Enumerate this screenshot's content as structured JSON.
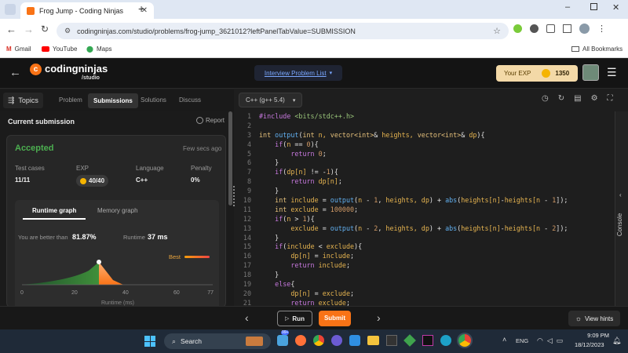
{
  "browser": {
    "tab_title": "Frog Jump - Coding Ninjas",
    "url": "codingninjas.com/studio/problems/frog-jump_3621012?leftPanelTabValue=SUBMISSION",
    "bookmarks": [
      "Gmail",
      "YouTube",
      "Maps"
    ],
    "all_bookmarks": "All Bookmarks"
  },
  "header": {
    "brand": "codingninjas",
    "brand_sub": "/studio",
    "nav_link": "Interview Problem List",
    "exp_label": "Your EXP",
    "exp_value": "1350"
  },
  "left_tabs": {
    "topics": "Topics",
    "items": [
      "Problem",
      "Submissions",
      "Solutions",
      "Discuss"
    ],
    "active": "Submissions"
  },
  "submission": {
    "heading": "Current submission",
    "report": "Report",
    "status": "Accepted",
    "time": "Few secs ago",
    "stats": [
      {
        "label": "Test cases",
        "value": "11/11"
      },
      {
        "label": "EXP",
        "value": "40/40"
      },
      {
        "label": "Language",
        "value": "C++"
      },
      {
        "label": "Penalty",
        "value": "0%"
      }
    ],
    "graph_tabs": [
      "Runtime graph",
      "Memory graph"
    ],
    "better_than_label": "You are better than",
    "better_than_value": "81.87%",
    "runtime_label": "Runtime",
    "runtime_value": "37 ms",
    "best_label": "Best",
    "x_ticks": [
      "0",
      "20",
      "40",
      "60",
      "77"
    ],
    "x_axis_label": "Runtime (ms)"
  },
  "editor": {
    "language": "C++ (g++ 5.4)",
    "lines": [
      {
        "n": "1",
        "tokens": [
          [
            "pp",
            "#include "
          ],
          [
            "str",
            "<bits/stdc++.h>"
          ]
        ]
      },
      {
        "n": "2",
        "tokens": []
      },
      {
        "n": "3",
        "tokens": [
          [
            "ty",
            "int "
          ],
          [
            "fn",
            "output"
          ],
          [
            "op",
            "("
          ],
          [
            "ty",
            "int "
          ],
          [
            "tx",
            "n, "
          ],
          [
            "ty",
            "vector<int>"
          ],
          [
            "op",
            "& "
          ],
          [
            "tx",
            "heights, "
          ],
          [
            "ty",
            "vector<int>"
          ],
          [
            "op",
            "& "
          ],
          [
            "tx",
            "dp"
          ],
          [
            "op",
            "){"
          ]
        ]
      },
      {
        "n": "4",
        "tokens": [
          [
            "op",
            "    "
          ],
          [
            "kw",
            "if"
          ],
          [
            "op",
            "("
          ],
          [
            "tx",
            "n "
          ],
          [
            "op",
            "== "
          ],
          [
            "nm",
            "0"
          ],
          [
            "op",
            "){"
          ]
        ]
      },
      {
        "n": "5",
        "tokens": [
          [
            "op",
            "        "
          ],
          [
            "kw",
            "return "
          ],
          [
            "nm",
            "0"
          ],
          [
            "op",
            ";"
          ]
        ]
      },
      {
        "n": "6",
        "tokens": [
          [
            "op",
            "    }"
          ]
        ]
      },
      {
        "n": "7",
        "tokens": [
          [
            "op",
            "    "
          ],
          [
            "kw",
            "if"
          ],
          [
            "op",
            "("
          ],
          [
            "tx",
            "dp[n] "
          ],
          [
            "op",
            "!= -"
          ],
          [
            "nm",
            "1"
          ],
          [
            "op",
            "){"
          ]
        ]
      },
      {
        "n": "8",
        "tokens": [
          [
            "op",
            "        "
          ],
          [
            "kw",
            "return "
          ],
          [
            "tx",
            "dp[n]"
          ],
          [
            "op",
            ";"
          ]
        ]
      },
      {
        "n": "9",
        "tokens": [
          [
            "op",
            "    }"
          ]
        ]
      },
      {
        "n": "10",
        "tokens": [
          [
            "op",
            "    "
          ],
          [
            "ty",
            "int "
          ],
          [
            "tx",
            "include "
          ],
          [
            "op",
            "= "
          ],
          [
            "fn",
            "output"
          ],
          [
            "op",
            "("
          ],
          [
            "tx",
            "n "
          ],
          [
            "op",
            "- "
          ],
          [
            "nm",
            "1"
          ],
          [
            "op",
            ", "
          ],
          [
            "tx",
            "heights, dp"
          ],
          [
            "op",
            ") + "
          ],
          [
            "fn",
            "abs"
          ],
          [
            "op",
            "("
          ],
          [
            "tx",
            "heights[n]"
          ],
          [
            "op",
            "-"
          ],
          [
            "tx",
            "heights[n "
          ],
          [
            "op",
            "- "
          ],
          [
            "nm",
            "1"
          ],
          [
            "op",
            "]);"
          ]
        ]
      },
      {
        "n": "11",
        "tokens": [
          [
            "op",
            "    "
          ],
          [
            "ty",
            "int "
          ],
          [
            "tx",
            "exclude "
          ],
          [
            "op",
            "= "
          ],
          [
            "nm",
            "100000"
          ],
          [
            "op",
            ";"
          ]
        ]
      },
      {
        "n": "12",
        "tokens": [
          [
            "op",
            "    "
          ],
          [
            "kw",
            "if"
          ],
          [
            "op",
            "("
          ],
          [
            "tx",
            "n "
          ],
          [
            "op",
            "> "
          ],
          [
            "nm",
            "1"
          ],
          [
            "op",
            "){"
          ]
        ]
      },
      {
        "n": "13",
        "tokens": [
          [
            "op",
            "        "
          ],
          [
            "tx",
            "exclude "
          ],
          [
            "op",
            "= "
          ],
          [
            "fn",
            "output"
          ],
          [
            "op",
            "("
          ],
          [
            "tx",
            "n "
          ],
          [
            "op",
            "- "
          ],
          [
            "nm",
            "2"
          ],
          [
            "op",
            ", "
          ],
          [
            "tx",
            "heights, dp"
          ],
          [
            "op",
            ") + "
          ],
          [
            "fn",
            "abs"
          ],
          [
            "op",
            "("
          ],
          [
            "tx",
            "heights[n]"
          ],
          [
            "op",
            "-"
          ],
          [
            "tx",
            "heights[n "
          ],
          [
            "op",
            "- "
          ],
          [
            "nm",
            "2"
          ],
          [
            "op",
            "]);"
          ]
        ]
      },
      {
        "n": "14",
        "tokens": [
          [
            "op",
            "    }"
          ]
        ]
      },
      {
        "n": "15",
        "tokens": [
          [
            "op",
            "    "
          ],
          [
            "kw",
            "if"
          ],
          [
            "op",
            "("
          ],
          [
            "tx",
            "include "
          ],
          [
            "op",
            "< "
          ],
          [
            "tx",
            "exclude"
          ],
          [
            "op",
            "){"
          ]
        ]
      },
      {
        "n": "16",
        "tokens": [
          [
            "op",
            "        "
          ],
          [
            "tx",
            "dp[n] "
          ],
          [
            "op",
            "= "
          ],
          [
            "tx",
            "include"
          ],
          [
            "op",
            ";"
          ]
        ]
      },
      {
        "n": "17",
        "tokens": [
          [
            "op",
            "        "
          ],
          [
            "kw",
            "return "
          ],
          [
            "tx",
            "include"
          ],
          [
            "op",
            ";"
          ]
        ]
      },
      {
        "n": "18",
        "tokens": [
          [
            "op",
            "    }"
          ]
        ]
      },
      {
        "n": "19",
        "tokens": [
          [
            "op",
            "    "
          ],
          [
            "kw",
            "else"
          ],
          [
            "op",
            "{"
          ]
        ]
      },
      {
        "n": "20",
        "tokens": [
          [
            "op",
            "        "
          ],
          [
            "tx",
            "dp[n] "
          ],
          [
            "op",
            "= "
          ],
          [
            "tx",
            "exclude"
          ],
          [
            "op",
            ";"
          ]
        ]
      },
      {
        "n": "21",
        "tokens": [
          [
            "op",
            "        "
          ],
          [
            "kw",
            "return "
          ],
          [
            "tx",
            "exclude"
          ],
          [
            "op",
            ";"
          ]
        ]
      }
    ]
  },
  "console": {
    "label": "Console"
  },
  "footer": {
    "run": "Run",
    "submit": "Submit",
    "view_hints": "View hints"
  },
  "taskbar": {
    "search": "Search",
    "lang": "ENG",
    "time": "9:09 PM",
    "date": "18/12/2023",
    "chat_badge": "99+"
  },
  "colors": {
    "accent": "#f97316",
    "accepted": "#4caf50",
    "coin": "#f5b400"
  }
}
